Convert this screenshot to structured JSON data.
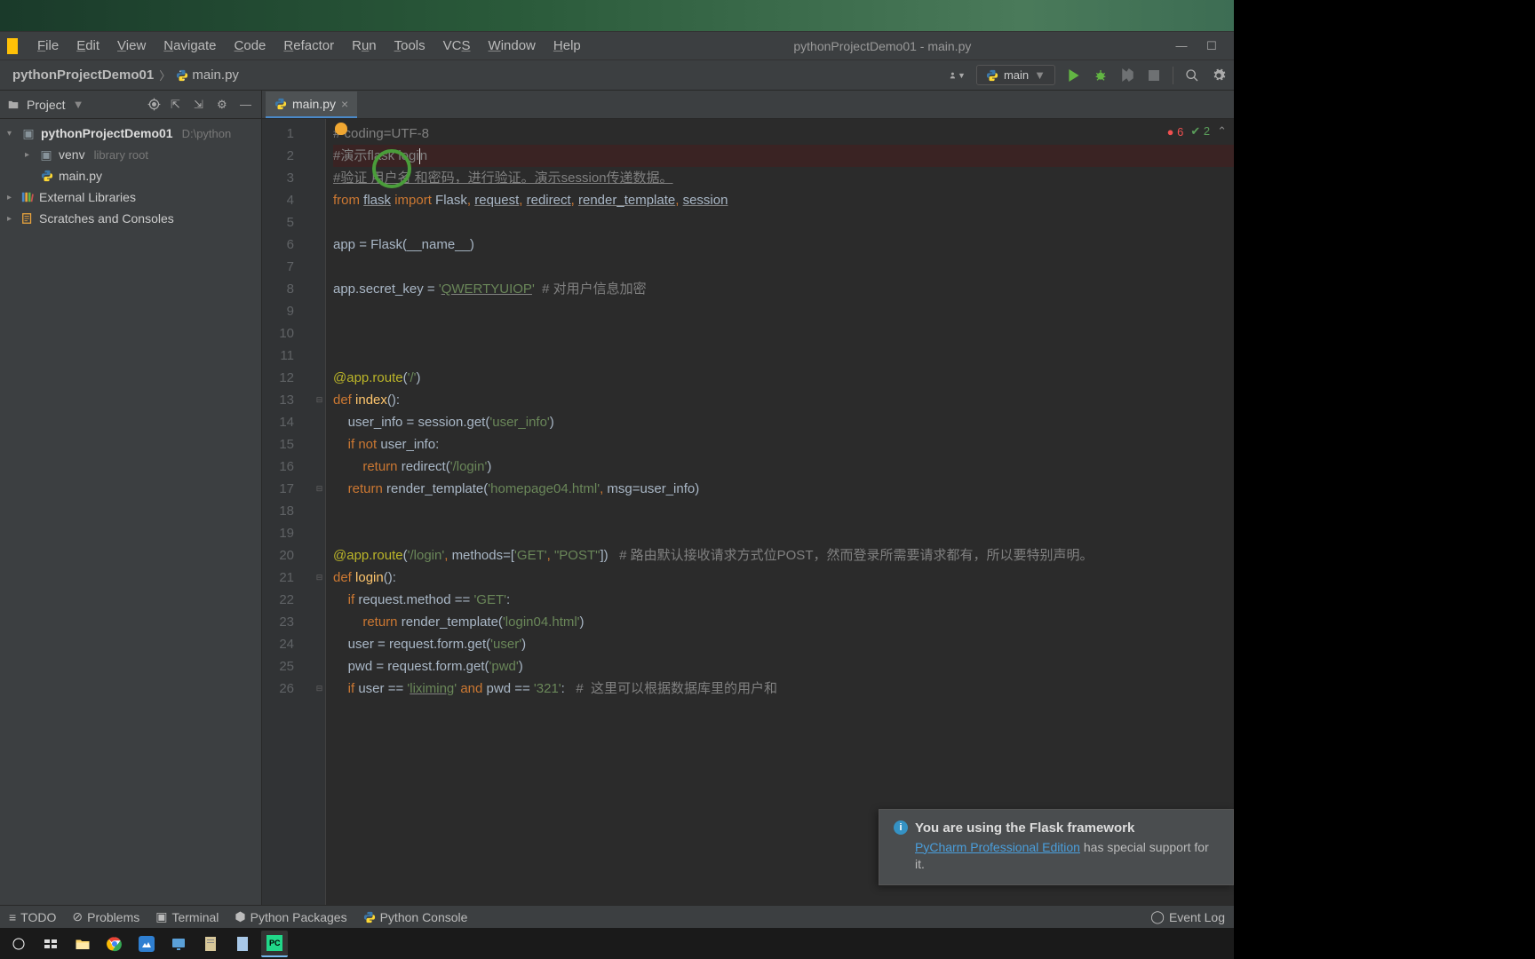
{
  "window": {
    "title": "pythonProjectDemo01 - main.py"
  },
  "menu": {
    "file": "File",
    "edit": "Edit",
    "view": "View",
    "navigate": "Navigate",
    "code": "Code",
    "refactor": "Refactor",
    "run": "Run",
    "tools": "Tools",
    "vcs": "VCS",
    "window": "Window",
    "help": "Help"
  },
  "breadcrumb": {
    "root": "pythonProjectDemo01",
    "file": "main.py"
  },
  "runConfig": {
    "name": "main"
  },
  "projectTool": {
    "label": "Project",
    "root": "pythonProjectDemo01",
    "rootPath": "D:\\python",
    "venv": "venv",
    "venvHint": "library root",
    "mainFile": "main.py",
    "ext": "External Libraries",
    "scratch": "Scratches and Consoles"
  },
  "editor": {
    "tab": "main.py",
    "lines": [
      "1",
      "2",
      "3",
      "4",
      "5",
      "6",
      "7",
      "8",
      "9",
      "10",
      "11",
      "12",
      "13",
      "14",
      "15",
      "16",
      "17",
      "18",
      "19",
      "20",
      "21",
      "22",
      "23",
      "24",
      "25",
      "26"
    ],
    "l1": "# coding=UTF-8",
    "l2": "#演示flask login",
    "l3": "#验证 用户名 和密码，进行验证。演示session传递数据。",
    "l8c": "  # 对用户信息加密",
    "l20c": "# 路由默认接收请求方式位POST，然而登录所需要请求都有，所以要特别声明。",
    "l26c": "#  这里可以根据数据库里的用户和"
  },
  "inspections": {
    "errors": "6",
    "warnings": "2"
  },
  "notification": {
    "title": "You are using the Flask framework",
    "link": "PyCharm Professional Edition",
    "rest": " has special support for it."
  },
  "bottom": {
    "todo": "TODO",
    "problems": "Problems",
    "terminal": "Terminal",
    "packages": "Python Packages",
    "console": "Python Console",
    "eventLog": "Event Log"
  }
}
